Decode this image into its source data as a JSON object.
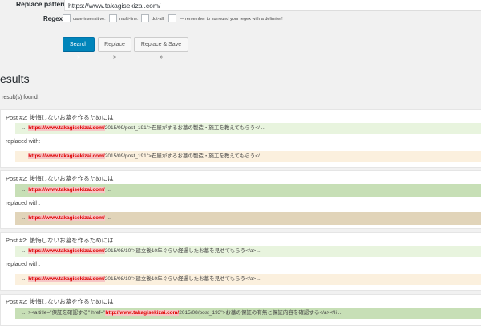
{
  "form": {
    "replace_label": "Replace pattern",
    "replace_value": "https://www.takagisekizai.com/",
    "regex_label": "Regex:",
    "options": [
      {
        "label": "case-insensitive:",
        "checked": false
      },
      {
        "label": "multi-line:",
        "checked": false
      },
      {
        "label": "dot-all:",
        "checked": false
      }
    ],
    "hint": "— remember to surround your regex with a delimiter!"
  },
  "buttons": {
    "search": "Search »",
    "replace": "Replace »",
    "replace_save": "Replace & Save »"
  },
  "results": {
    "heading": "esults",
    "count_text": "result(s) found.",
    "replaced_with_label": "replaced with:",
    "items": [
      {
        "title": "Post #2: 後悔しないお墓を作るためには",
        "orig_prefix": "... ",
        "orig_url": "https://www.takagisekizai.com/",
        "orig_suffix": "2015/09/post_191\">石屋がするお墓の製造・施工を教えてもらう</ ...",
        "rep_prefix": "... ",
        "rep_url": "https://www.takagisekizai.com/",
        "rep_suffix": "2015/09/post_191\">石屋がするお墓の製造・施工を教えてもらう</ ..."
      },
      {
        "title": "Post #2: 後悔しないお墓を作るためには",
        "orig_prefix": "... ",
        "orig_url": "https://www.takagisekizai.com/",
        "orig_suffix": " ...",
        "rep_prefix": "... ",
        "rep_url": "https://www.takagisekizai.com/",
        "rep_suffix": " ..."
      },
      {
        "title": "Post #2: 後悔しないお墓を作るためには",
        "orig_prefix": "... ",
        "orig_url": "https://www.takagisekizai.com/",
        "orig_suffix": "2015/08/10\">建立後10年ぐらい経過したお墓を見せてもらう</a> ...",
        "rep_prefix": "... ",
        "rep_url": "https://www.takagisekizai.com/",
        "rep_suffix": "2015/08/10\">建立後10年ぐらい経過したお墓を見せてもらう</a> ..."
      },
      {
        "title": "Post #2: 後悔しないお墓を作るためには",
        "orig_prefix": "... ><a title=\"保証を確認する\" href=\"",
        "orig_url": "http://www.takagisekizai.com/",
        "orig_suffix": "2015/08/post_193\">お墓の保証の有無と保証内容を確認する</a></li ..."
      }
    ]
  },
  "colors": {
    "primary_button": "#0085ba",
    "url_highlight": "#d00",
    "original_line": "#e8f4de",
    "replaced_line": "#fbf0de"
  }
}
